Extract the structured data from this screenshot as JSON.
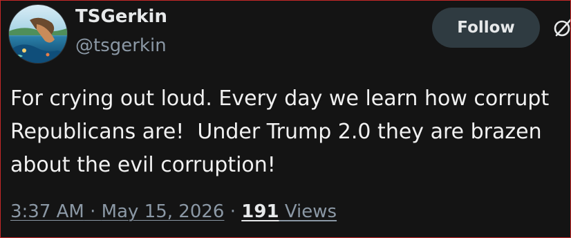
{
  "user": {
    "display_name": "TSGerkin",
    "handle": "@tsgerkin"
  },
  "actions": {
    "follow_label": "Follow"
  },
  "tweet": {
    "text": "For crying out loud. Every day we learn how corrupt\nRepublicans are!  Under Trump 2.0 they are brazen\nabout the evil corruption!"
  },
  "meta": {
    "time": "3:37 AM",
    "separator": " · ",
    "date": "May 15, 2026",
    "separator2": " · ",
    "view_count": "191",
    "views_label": " Views"
  },
  "icons": {
    "more": "grok-icon"
  },
  "colors": {
    "background": "#141414",
    "border": "#c62828",
    "follow_bg": "#2f3b41",
    "muted_text": "#8b98a5"
  }
}
